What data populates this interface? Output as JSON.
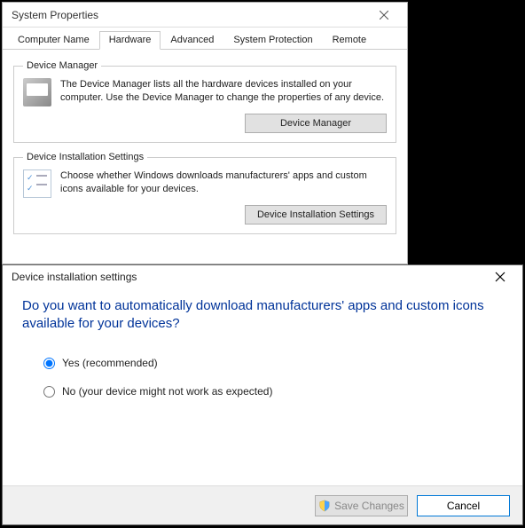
{
  "sysprop": {
    "title": "System Properties",
    "tabs": [
      "Computer Name",
      "Hardware",
      "Advanced",
      "System Protection",
      "Remote"
    ],
    "active_tab": 1,
    "device_manager": {
      "legend": "Device Manager",
      "desc": "The Device Manager lists all the hardware devices installed on your computer. Use the Device Manager to change the properties of any device.",
      "button": "Device Manager"
    },
    "install_settings": {
      "legend": "Device Installation Settings",
      "desc": "Choose whether Windows downloads manufacturers' apps and custom icons available for your devices.",
      "button": "Device Installation Settings"
    }
  },
  "dialog": {
    "title": "Device installation settings",
    "question": "Do you want to automatically download manufacturers' apps and custom icons available for your devices?",
    "options": {
      "yes": "Yes (recommended)",
      "no": "No (your device might not work as expected)"
    },
    "selected": "yes",
    "save_label": "Save Changes",
    "cancel_label": "Cancel"
  }
}
